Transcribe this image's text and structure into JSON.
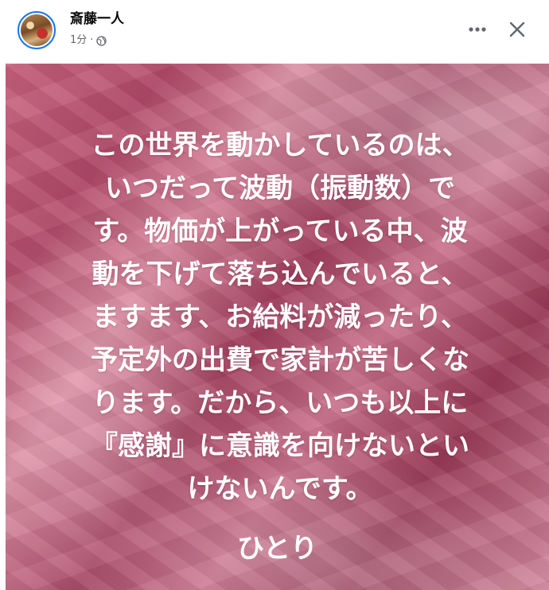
{
  "post": {
    "author": "斎藤一人",
    "time": "1分",
    "separator": "·",
    "privacy_icon": "globe-icon"
  },
  "actions": {
    "more_icon": "more-horizontal-icon",
    "close_icon": "close-icon"
  },
  "image": {
    "lines": [
      "この世界を動かしているのは、",
      "いつだって波動（振動数）で",
      "す。物価が上がっている中、波",
      "動を下げて落ち込んでいると、",
      "ますます、お給料が減ったり、",
      "予定外の出費で家計が苦しくな",
      "ります。だから、いつも以上に",
      "『感謝』に意識を向けないとい",
      "けないんです。"
    ],
    "signature": "ひとり",
    "text_color": "#ffffff",
    "background_color": "#c06a85"
  }
}
